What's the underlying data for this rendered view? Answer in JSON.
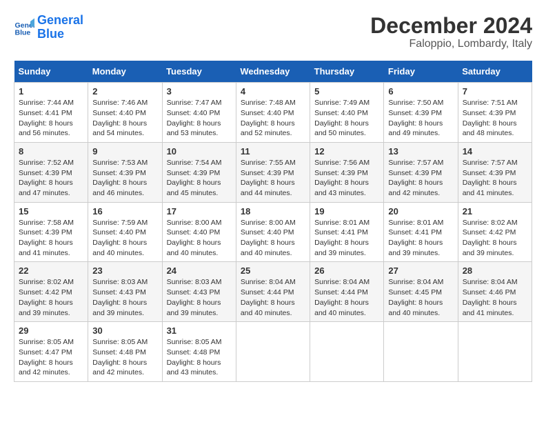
{
  "logo": {
    "line1": "General",
    "line2": "Blue"
  },
  "title": "December 2024",
  "location": "Faloppio, Lombardy, Italy",
  "weekdays": [
    "Sunday",
    "Monday",
    "Tuesday",
    "Wednesday",
    "Thursday",
    "Friday",
    "Saturday"
  ],
  "weeks": [
    [
      {
        "day": "1",
        "sunrise": "7:44 AM",
        "sunset": "4:41 PM",
        "daylight": "8 hours and 56 minutes."
      },
      {
        "day": "2",
        "sunrise": "7:46 AM",
        "sunset": "4:40 PM",
        "daylight": "8 hours and 54 minutes."
      },
      {
        "day": "3",
        "sunrise": "7:47 AM",
        "sunset": "4:40 PM",
        "daylight": "8 hours and 53 minutes."
      },
      {
        "day": "4",
        "sunrise": "7:48 AM",
        "sunset": "4:40 PM",
        "daylight": "8 hours and 52 minutes."
      },
      {
        "day": "5",
        "sunrise": "7:49 AM",
        "sunset": "4:40 PM",
        "daylight": "8 hours and 50 minutes."
      },
      {
        "day": "6",
        "sunrise": "7:50 AM",
        "sunset": "4:39 PM",
        "daylight": "8 hours and 49 minutes."
      },
      {
        "day": "7",
        "sunrise": "7:51 AM",
        "sunset": "4:39 PM",
        "daylight": "8 hours and 48 minutes."
      }
    ],
    [
      {
        "day": "8",
        "sunrise": "7:52 AM",
        "sunset": "4:39 PM",
        "daylight": "8 hours and 47 minutes."
      },
      {
        "day": "9",
        "sunrise": "7:53 AM",
        "sunset": "4:39 PM",
        "daylight": "8 hours and 46 minutes."
      },
      {
        "day": "10",
        "sunrise": "7:54 AM",
        "sunset": "4:39 PM",
        "daylight": "8 hours and 45 minutes."
      },
      {
        "day": "11",
        "sunrise": "7:55 AM",
        "sunset": "4:39 PM",
        "daylight": "8 hours and 44 minutes."
      },
      {
        "day": "12",
        "sunrise": "7:56 AM",
        "sunset": "4:39 PM",
        "daylight": "8 hours and 43 minutes."
      },
      {
        "day": "13",
        "sunrise": "7:57 AM",
        "sunset": "4:39 PM",
        "daylight": "8 hours and 42 minutes."
      },
      {
        "day": "14",
        "sunrise": "7:57 AM",
        "sunset": "4:39 PM",
        "daylight": "8 hours and 41 minutes."
      }
    ],
    [
      {
        "day": "15",
        "sunrise": "7:58 AM",
        "sunset": "4:39 PM",
        "daylight": "8 hours and 41 minutes."
      },
      {
        "day": "16",
        "sunrise": "7:59 AM",
        "sunset": "4:40 PM",
        "daylight": "8 hours and 40 minutes."
      },
      {
        "day": "17",
        "sunrise": "8:00 AM",
        "sunset": "4:40 PM",
        "daylight": "8 hours and 40 minutes."
      },
      {
        "day": "18",
        "sunrise": "8:00 AM",
        "sunset": "4:40 PM",
        "daylight": "8 hours and 40 minutes."
      },
      {
        "day": "19",
        "sunrise": "8:01 AM",
        "sunset": "4:41 PM",
        "daylight": "8 hours and 39 minutes."
      },
      {
        "day": "20",
        "sunrise": "8:01 AM",
        "sunset": "4:41 PM",
        "daylight": "8 hours and 39 minutes."
      },
      {
        "day": "21",
        "sunrise": "8:02 AM",
        "sunset": "4:42 PM",
        "daylight": "8 hours and 39 minutes."
      }
    ],
    [
      {
        "day": "22",
        "sunrise": "8:02 AM",
        "sunset": "4:42 PM",
        "daylight": "8 hours and 39 minutes."
      },
      {
        "day": "23",
        "sunrise": "8:03 AM",
        "sunset": "4:43 PM",
        "daylight": "8 hours and 39 minutes."
      },
      {
        "day": "24",
        "sunrise": "8:03 AM",
        "sunset": "4:43 PM",
        "daylight": "8 hours and 39 minutes."
      },
      {
        "day": "25",
        "sunrise": "8:04 AM",
        "sunset": "4:44 PM",
        "daylight": "8 hours and 40 minutes."
      },
      {
        "day": "26",
        "sunrise": "8:04 AM",
        "sunset": "4:44 PM",
        "daylight": "8 hours and 40 minutes."
      },
      {
        "day": "27",
        "sunrise": "8:04 AM",
        "sunset": "4:45 PM",
        "daylight": "8 hours and 40 minutes."
      },
      {
        "day": "28",
        "sunrise": "8:04 AM",
        "sunset": "4:46 PM",
        "daylight": "8 hours and 41 minutes."
      }
    ],
    [
      {
        "day": "29",
        "sunrise": "8:05 AM",
        "sunset": "4:47 PM",
        "daylight": "8 hours and 42 minutes."
      },
      {
        "day": "30",
        "sunrise": "8:05 AM",
        "sunset": "4:48 PM",
        "daylight": "8 hours and 42 minutes."
      },
      {
        "day": "31",
        "sunrise": "8:05 AM",
        "sunset": "4:48 PM",
        "daylight": "8 hours and 43 minutes."
      },
      null,
      null,
      null,
      null
    ]
  ]
}
